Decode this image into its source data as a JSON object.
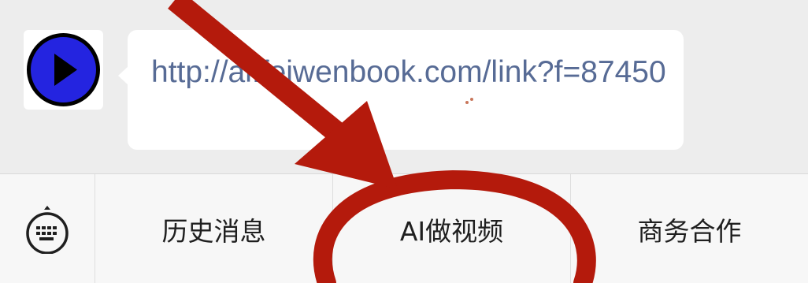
{
  "chat": {
    "message": {
      "link_text": "http://ai.feiwenbook.com/link?f=87450"
    },
    "avatar_icon": "play-icon"
  },
  "menu": {
    "keyboard_icon": "keyboard-icon",
    "items": [
      {
        "label": "历史消息"
      },
      {
        "label": "AI做视频"
      },
      {
        "label": "商务合作"
      }
    ]
  },
  "annotation": {
    "color": "#b41a0c",
    "shapes": [
      "arrow",
      "circle"
    ]
  },
  "colors": {
    "background": "#ededed",
    "bubble": "#ffffff",
    "link": "#576b95",
    "menu_bar": "#f7f7f7",
    "avatar_fill": "#2424e0"
  }
}
